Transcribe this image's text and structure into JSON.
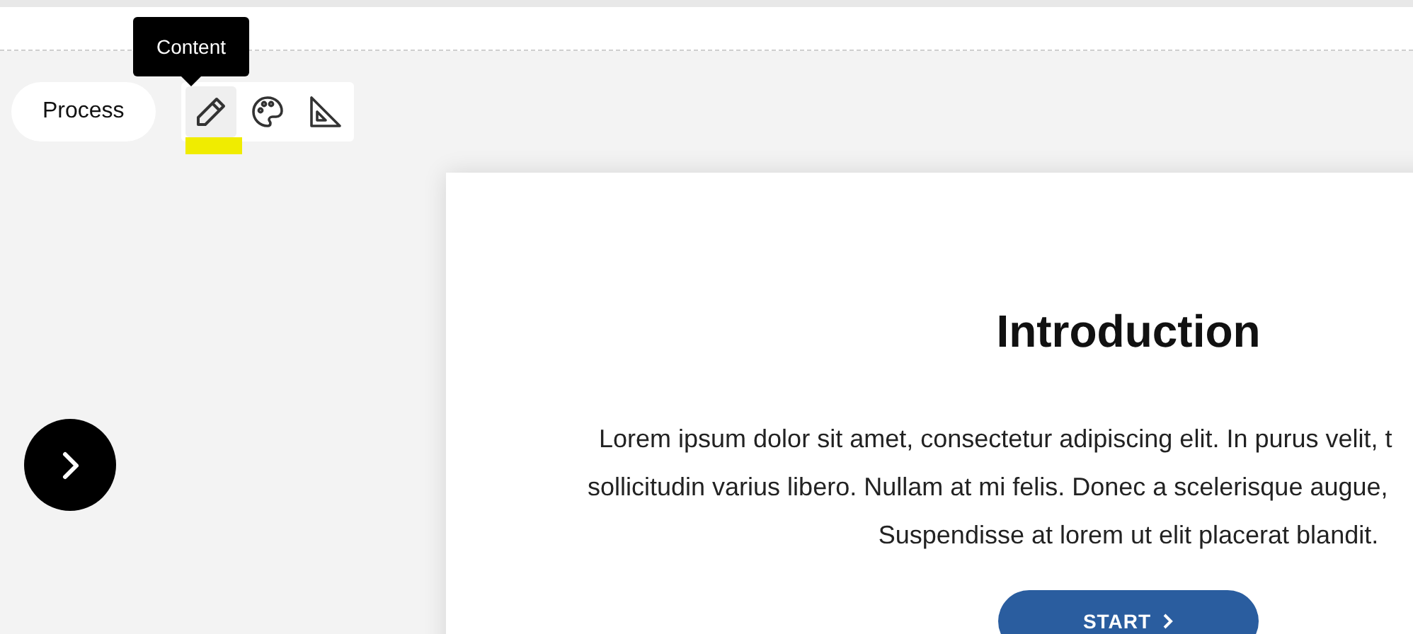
{
  "tooltip": {
    "text": "Content"
  },
  "step_label": "Process",
  "toolbar": [
    {
      "kind": "pencil",
      "selected": true
    },
    {
      "kind": "palette",
      "selected": false
    },
    {
      "kind": "ruler",
      "selected": false
    }
  ],
  "card": {
    "title": "Introduction",
    "lines": [
      "Lorem ipsum dolor sit amet, consectetur adipiscing elit. In purus velit, t",
      "sollicitudin varius libero. Nullam at mi felis. Donec a scelerisque augue,",
      "Suspendisse at lorem ut elit placerat blandit."
    ],
    "button": "START"
  }
}
